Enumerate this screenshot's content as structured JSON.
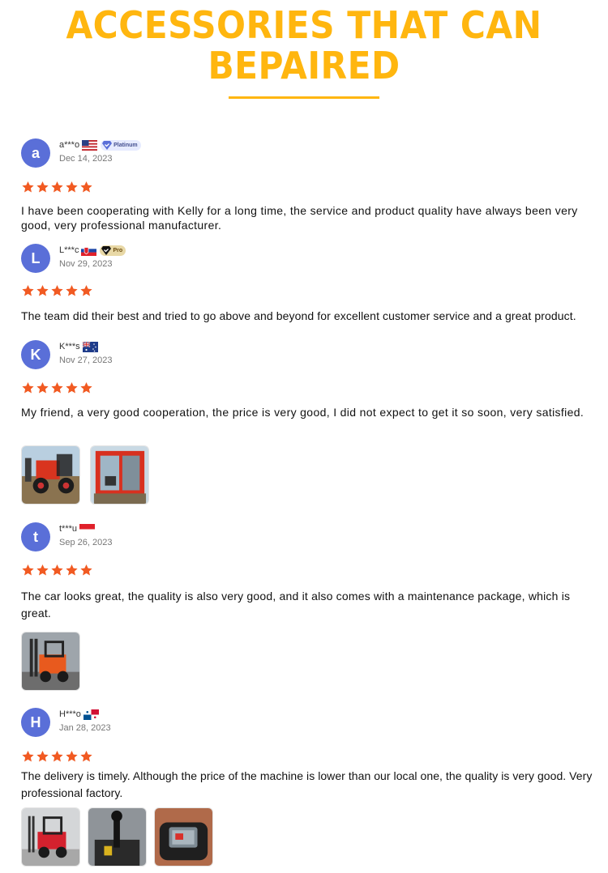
{
  "header": {
    "title_line1": "ACCESSORIES THAT CAN",
    "title_line2": "BEPAIRED"
  },
  "colors": {
    "title": "#ffb60f",
    "avatar": "#5a6fd8",
    "star": "#f15a22"
  },
  "reviews": [
    {
      "initial": "a",
      "name": "a***o",
      "flag": "us-flag-icon",
      "badge": "Platinum",
      "date": "Dec 14, 2023",
      "rating": 5,
      "text": "I have been cooperating with Kelly for a long time, the service and product quality have always been very good, very professional manufacturer."
    },
    {
      "initial": "L",
      "name": "L***c",
      "flag": "slovakia-flag-icon",
      "badge": "Pro",
      "date": "Nov 29, 2023",
      "rating": 5,
      "text": "The team did their best and tried to go above and beyond for excellent customer service and a great product."
    },
    {
      "initial": "K",
      "name": "K***s",
      "flag": "australia-flag-icon",
      "date": "Nov 27, 2023",
      "rating": 5,
      "text": "My friend, a very good cooperation, the price is very good, I did not expect to get it so soon, very satisfied."
    },
    {
      "initial": "t",
      "name": "t***u",
      "flag": "indonesia-flag-icon",
      "date": "Sep 26, 2023",
      "rating": 5,
      "text": "The car looks great, the quality is also very good, and it also comes with a maintenance package, which is great."
    },
    {
      "initial": "H",
      "name": "H***o",
      "flag": "panama-flag-icon",
      "date": "Jan 28, 2023",
      "rating": 5,
      "text": "The delivery is timely. Although the price of the machine is lower than our local one, the quality is very good. Very professional factory."
    }
  ]
}
